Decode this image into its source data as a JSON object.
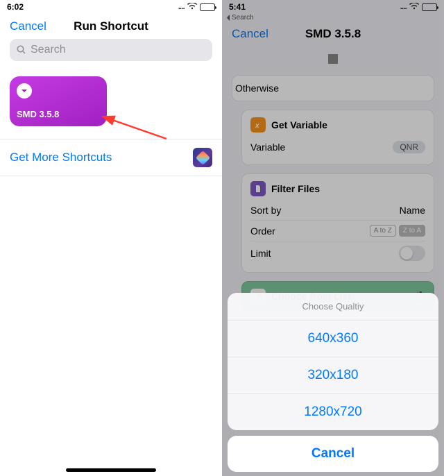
{
  "left": {
    "status": {
      "time": "6:02",
      "dots": "....",
      "wifi": "wifi-icon"
    },
    "nav": {
      "cancel": "Cancel",
      "title": "Run Shortcut"
    },
    "search": {
      "placeholder": "Search"
    },
    "tile": {
      "label": "SMD 3.5.8"
    },
    "more_row": {
      "label": "Get More Shortcuts"
    }
  },
  "right": {
    "status": {
      "time": "5:41",
      "dots": "...."
    },
    "mini_back": "Search",
    "nav": {
      "cancel": "Cancel",
      "title": "SMD 3.5.8"
    },
    "otherwise": "Otherwise",
    "get_var": {
      "title": "Get Variable",
      "k1": "Variable",
      "v1": "QNR"
    },
    "filter": {
      "title": "Filter Files",
      "sortby_k": "Sort by",
      "sortby_v": "Name",
      "order_k": "Order",
      "seg_a": "A to Z",
      "seg_b": "Z to A",
      "limit_k": "Limit"
    },
    "choose": {
      "title": "Choose from List"
    },
    "sheet": {
      "title": "Choose Qualtiy",
      "options": [
        "640x360",
        "320x180",
        "1280x720"
      ],
      "cancel": "Cancel"
    }
  }
}
